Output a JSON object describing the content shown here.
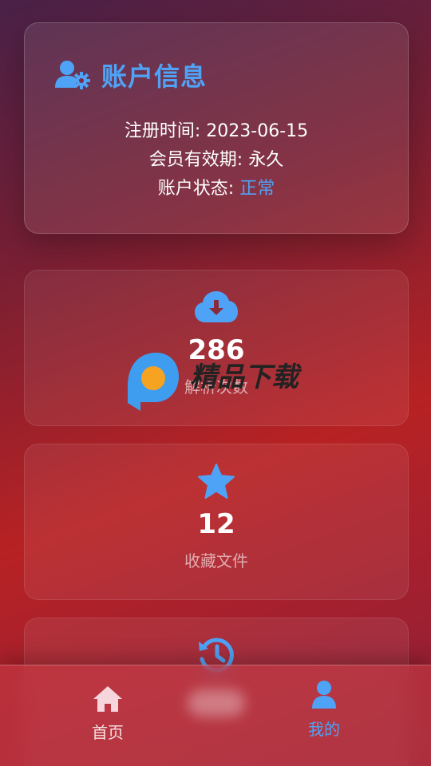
{
  "account": {
    "title": "账户信息",
    "icon": "user-gear-icon",
    "register_label": "注册时间:",
    "register_value": "2023-06-15",
    "membership_label": "会员有效期:",
    "membership_value": "永久",
    "status_label": "账户状态:",
    "status_value": "正常"
  },
  "stats": [
    {
      "icon": "cloud-download-icon",
      "value": "286",
      "label": "解析次数"
    },
    {
      "icon": "star-icon",
      "value": "12",
      "label": "收藏文件"
    },
    {
      "icon": "history-icon",
      "value": "",
      "label": ""
    }
  ],
  "watermark": {
    "text": "精品下载",
    "icon": "p-logo-icon"
  },
  "nav": {
    "items": [
      {
        "label": "首页",
        "icon": "home-icon",
        "active": false
      },
      {
        "label": "我的",
        "icon": "user-icon",
        "active": true
      }
    ]
  },
  "colors": {
    "accent": "#4fa3f7",
    "text": "#ffffff",
    "muted": "#c9a0a6"
  }
}
